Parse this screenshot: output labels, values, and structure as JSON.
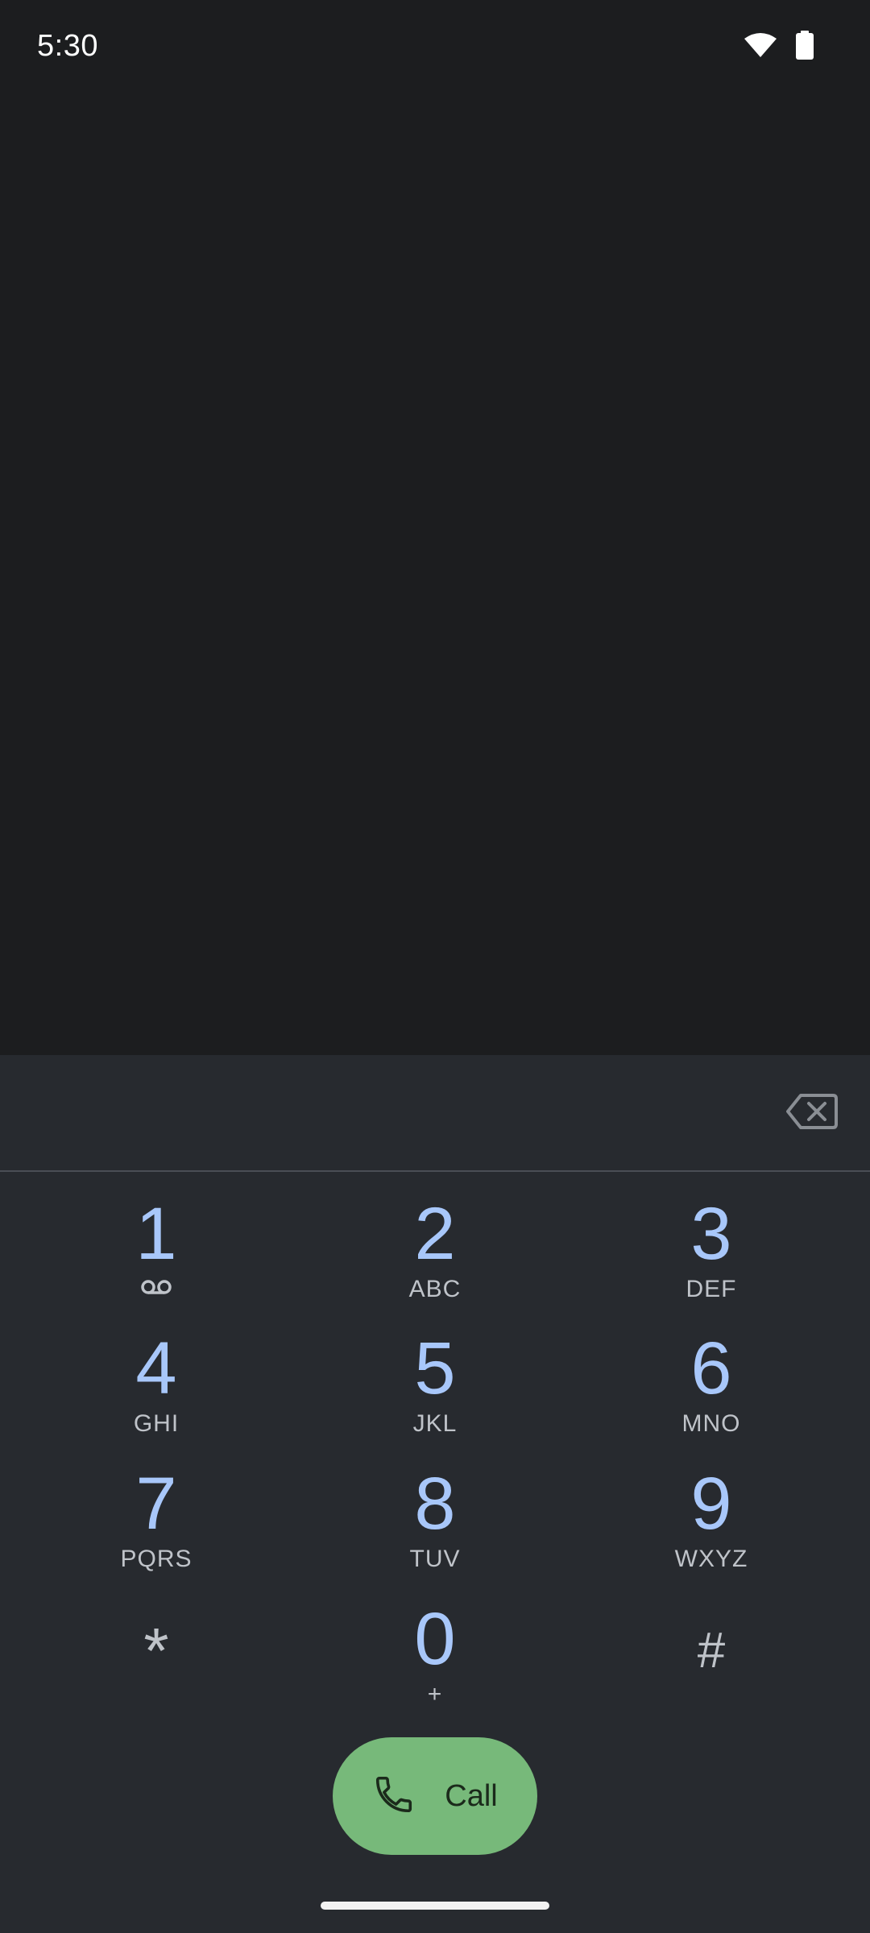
{
  "status_bar": {
    "time": "5:30",
    "icons": [
      "wifi-icon",
      "battery-icon"
    ]
  },
  "dialpad": {
    "digits": "",
    "backspace_icon": "backspace-icon",
    "keys": [
      {
        "digit": "1",
        "letters": "",
        "icon": "voicemail-icon"
      },
      {
        "digit": "2",
        "letters": "ABC"
      },
      {
        "digit": "3",
        "letters": "DEF"
      },
      {
        "digit": "4",
        "letters": "GHI"
      },
      {
        "digit": "5",
        "letters": "JKL"
      },
      {
        "digit": "6",
        "letters": "MNO"
      },
      {
        "digit": "7",
        "letters": "PQRS"
      },
      {
        "digit": "8",
        "letters": "TUV"
      },
      {
        "digit": "9",
        "letters": "WXYZ"
      },
      {
        "digit": "*",
        "letters": ""
      },
      {
        "digit": "0",
        "letters": "+"
      },
      {
        "digit": "#",
        "letters": ""
      }
    ]
  },
  "call_button": {
    "label": "Call",
    "icon": "phone-icon"
  },
  "colors": {
    "background": "#1c1d1f",
    "sheet": "#272a2f",
    "digit": "#a8c7fa",
    "letters": "#bfc3c9",
    "call_button": "#77b97a"
  }
}
